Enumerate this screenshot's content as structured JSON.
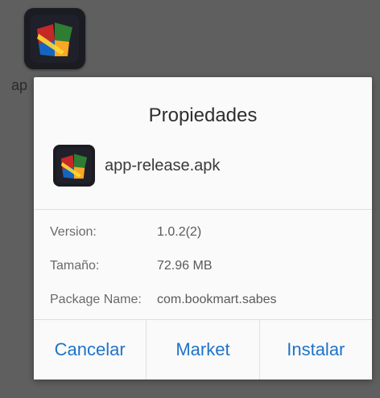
{
  "background": {
    "app_label": "ap"
  },
  "dialog": {
    "title": "Propiedades",
    "file_name": "app-release.apk",
    "fields": [
      {
        "label": "Version:",
        "value": "1.0.2(2)"
      },
      {
        "label": "Tamaño:",
        "value": "72.96 MB"
      },
      {
        "label": "Package Name:",
        "value": "com.bookmart.sabes"
      }
    ],
    "buttons": {
      "cancel": "Cancelar",
      "market": "Market",
      "install": "Instalar"
    }
  },
  "colors": {
    "accent": "#1f73c9",
    "scrim": "#5f5f5f",
    "dialog_bg": "#fafafa"
  },
  "icons": {
    "app_icon": "windows-flag-app-icon"
  }
}
